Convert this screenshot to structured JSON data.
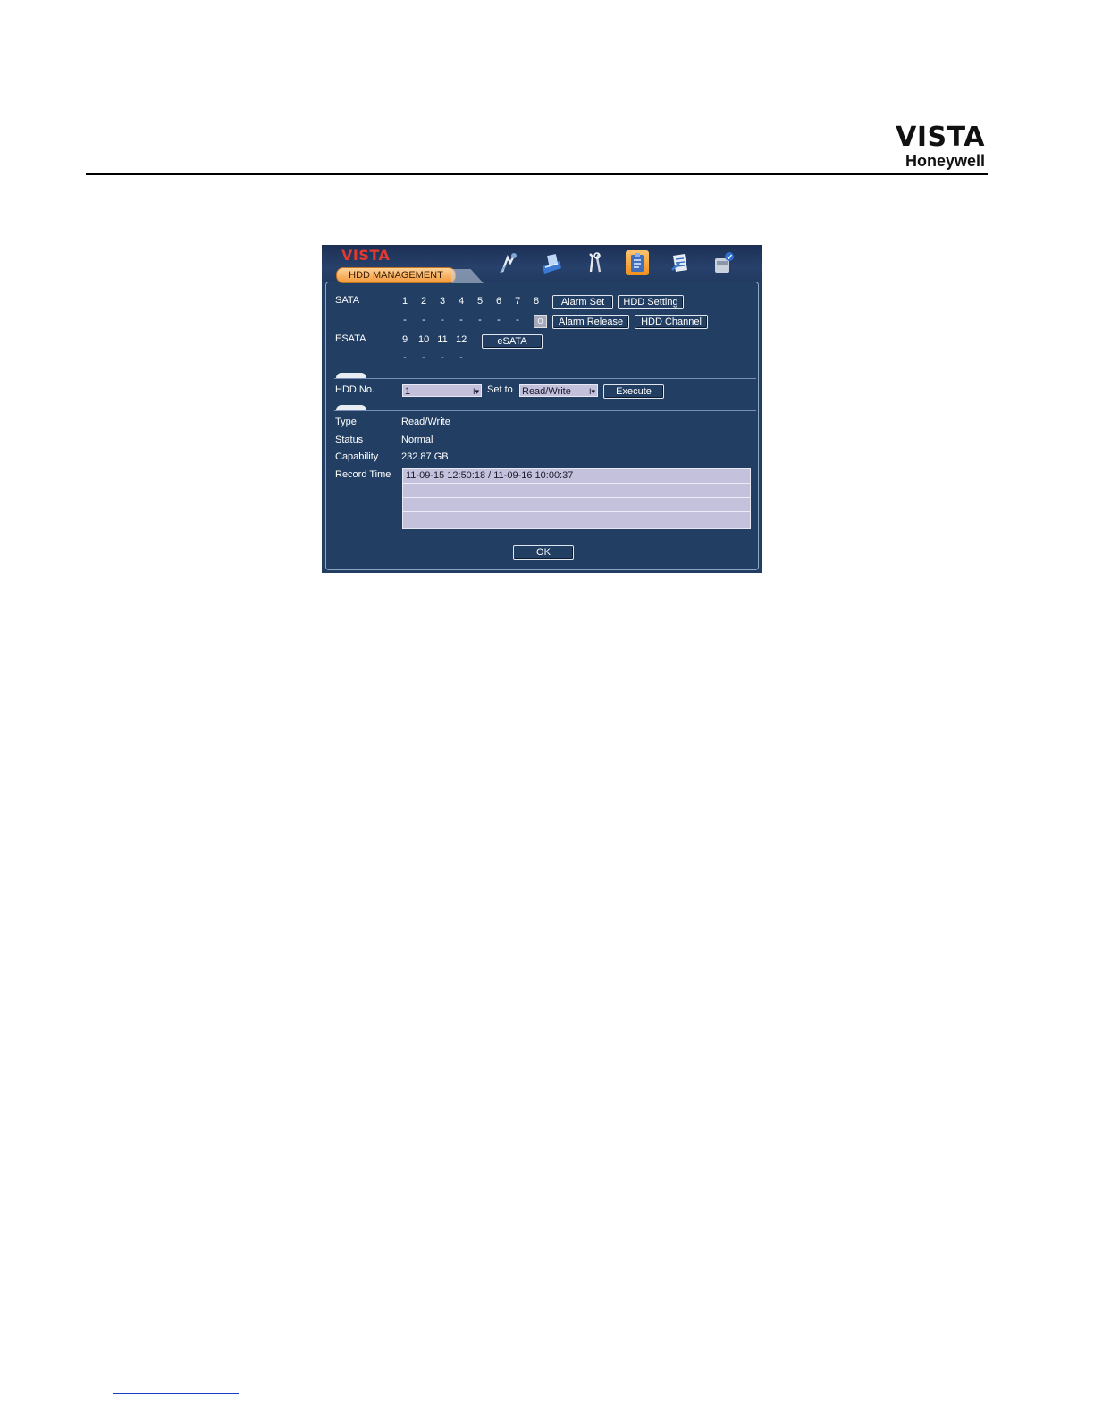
{
  "doc": {
    "brand_top": "VISTA",
    "brand_bottom": "Honeywell"
  },
  "dvr": {
    "logo": "VISTA",
    "tab_label": "HDD MANAGEMENT",
    "toolbar_icons": [
      "search-person-icon",
      "note-book-icon",
      "tools-icon",
      "clipboard-icon",
      "document-icon",
      "disk-icon"
    ],
    "sata": {
      "label": "SATA",
      "numbers": [
        "1",
        "2",
        "3",
        "4",
        "5",
        "6",
        "7",
        "8"
      ],
      "dashes": [
        "-",
        "-",
        "-",
        "-",
        "-",
        "-",
        "-",
        "-"
      ],
      "indicator": "O"
    },
    "esata": {
      "label": "ESATA",
      "numbers": [
        "9",
        "10",
        "11",
        "12"
      ],
      "dashes": [
        "-",
        "-",
        "-",
        "-"
      ]
    },
    "buttons": {
      "alarm_set": "Alarm Set",
      "hdd_setting": "HDD Setting",
      "alarm_release": "Alarm Release",
      "hdd_channel": "HDD Channel",
      "esata": "eSATA",
      "execute": "Execute",
      "ok": "OK"
    },
    "hdd": {
      "label": "HDD No.",
      "value": "1",
      "set_to_label": "Set to",
      "set_to_value": "Read/Write"
    },
    "info": {
      "type_label": "Type",
      "type_value": "Read/Write",
      "status_label": "Status",
      "status_value": "Normal",
      "capability_label": "Capability",
      "capability_value": "232.87 GB",
      "record_label": "Record Time",
      "records": [
        "11-09-15 12:50:18 / 11-09-16 10:00:37",
        "",
        "",
        ""
      ]
    }
  }
}
